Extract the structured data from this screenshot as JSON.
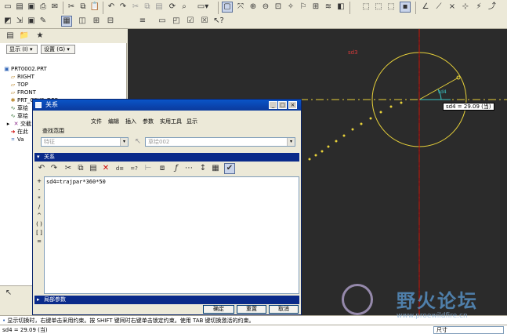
{
  "toolbar": {
    "icons": [
      "new-icon",
      "open-icon",
      "save-icon",
      "print-icon",
      "email-icon",
      "cut-icon",
      "copy-icon",
      "paste-icon",
      "undo-icon",
      "redo-icon",
      "regenerate-icon",
      "zoom-in-icon",
      "zoom-out-icon",
      "refit-icon",
      "repaint-icon",
      "view-manager-icon",
      "saved-views-icon",
      "layers-icon",
      "wireframe-icon",
      "hidden-line-icon",
      "no-hidden-icon",
      "shading-icon",
      "datum-plane-icon",
      "datum-axis-icon",
      "datum-point-icon",
      "coord-sys-icon",
      "annotation-icon"
    ]
  },
  "left_panel": {
    "show_label": "显示 (I) ▾",
    "settings_label": "设置 (G) ▾",
    "tree": [
      {
        "icon": "part",
        "label": "PRT0002.PRT"
      },
      {
        "icon": "plane",
        "label": "RIGHT"
      },
      {
        "icon": "plane",
        "label": "TOP"
      },
      {
        "icon": "plane",
        "label": "FRONT"
      },
      {
        "icon": "csys",
        "label": "PRT_CSYS_DEF"
      },
      {
        "icon": "feature",
        "label": "草绘"
      },
      {
        "icon": "feature",
        "label": "草绘"
      },
      {
        "icon": "feature",
        "label": "交截"
      },
      {
        "icon": "insert",
        "label": "在此"
      },
      {
        "icon": "feature",
        "label": "Va"
      }
    ]
  },
  "dialog": {
    "title": "关系",
    "menu": [
      "文件",
      "编辑",
      "插入",
      "参数",
      "实用工具",
      "显示"
    ],
    "lookup_label": "查找范围",
    "lookup_left_value": "特征",
    "lookup_right_value": "草绘002",
    "section_relations": "关系",
    "section_local_params": "局部参数",
    "relation_text": "sd4=trajpar*360*50",
    "operators": [
      "+",
      "-",
      "*",
      "/",
      "^",
      "( )",
      "[ ]",
      "="
    ],
    "buttons": {
      "ok": "确定",
      "reset": "重置",
      "cancel": "取消"
    }
  },
  "canvas": {
    "dim_label": "sd4 = 29.09 (当)",
    "small_label": "sd4",
    "top_label": "sd3"
  },
  "message_area": {
    "line": "显示切换时，右键单击采用约束。按 SHIFT 键同时右键单击锁定约束。使用 TAB 键切换激活的约束。"
  },
  "statusbar": {
    "left_text": "sd4 = 29.09 (当)",
    "right_text": "尺寸"
  },
  "watermark": {
    "title": "野火论坛",
    "url": "www.proewildfire.cn"
  },
  "colors": {
    "canvas_bg": "#2b2b2b",
    "sketch_yellow": "#e8d23a",
    "dialog_title": "#0a54c8",
    "section_bar": "#0a2a8a"
  }
}
